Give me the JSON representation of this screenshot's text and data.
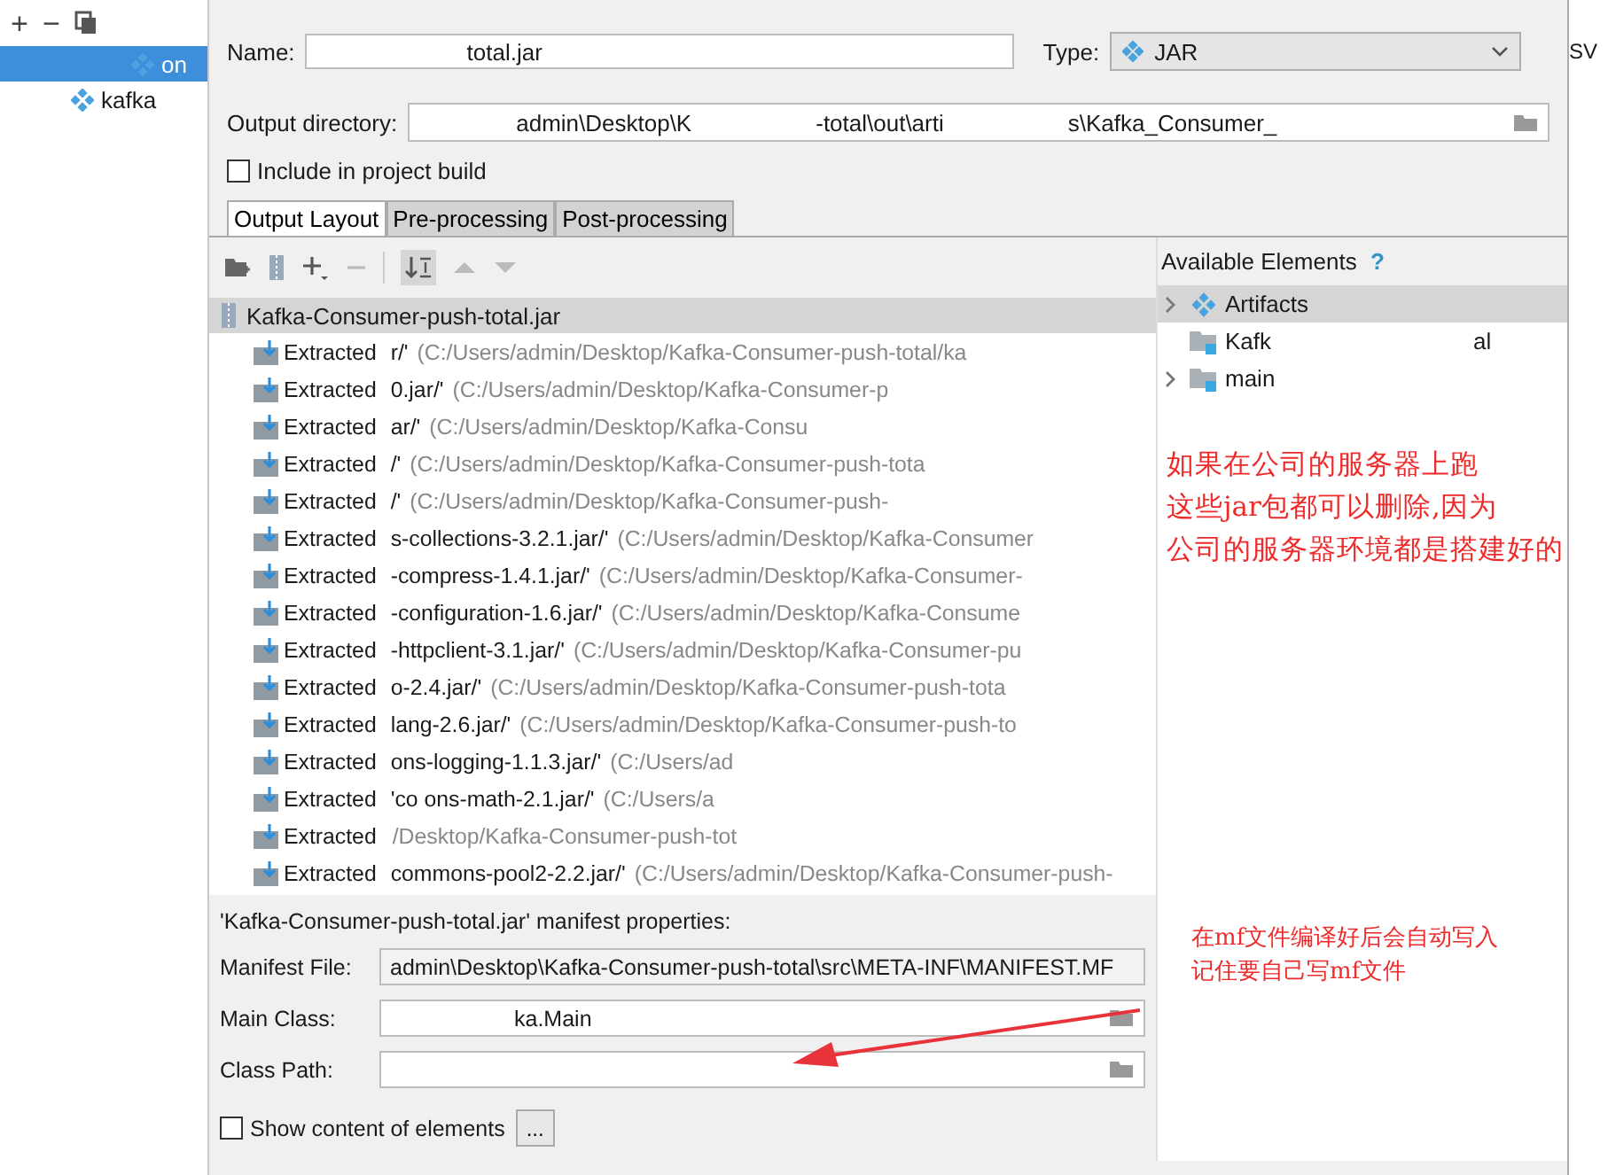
{
  "sidebar": {
    "toolbar": [
      "+",
      "−"
    ],
    "items": [
      {
        "label": "on",
        "selected": true
      },
      {
        "label": "kafka",
        "selected": false
      }
    ]
  },
  "form": {
    "name_label": "Name:",
    "name_value": "total.jar",
    "type_label": "Type:",
    "type_value": "JAR",
    "output_label": "Output directory:",
    "output_parts": [
      "admin\\Desktop\\K",
      "-total\\out\\arti",
      "s\\Kafka_Consumer_"
    ],
    "include_label": "Include in project build",
    "include_checked": false
  },
  "tabs": [
    {
      "label": "Output Layout",
      "selected": true
    },
    {
      "label": "Pre-processing",
      "selected": false
    },
    {
      "label": "Post-processing",
      "selected": false
    }
  ],
  "layout": {
    "root": "Kafka-Consumer-push-total.jar",
    "rows": [
      {
        "label": "Extracted",
        "file": "r/'",
        "path": "(C:/Users/admin/Desktop/Kafka-Consumer-push-total/ka"
      },
      {
        "label": "Extracted",
        "file": "0.jar/'",
        "path": "(C:/Users/admin/Desktop/Kafka-Consumer-p"
      },
      {
        "label": "Extracted",
        "file": "ar/'",
        "path": "(C:/Users/admin/Desktop/Kafka-Consu"
      },
      {
        "label": "Extracted",
        "file": "/'",
        "path": "(C:/Users/admin/Desktop/Kafka-Consumer-push-tota"
      },
      {
        "label": "Extracted",
        "file": "/'",
        "path": "(C:/Users/admin/Desktop/Kafka-Consumer-push-"
      },
      {
        "label": "Extracted",
        "file": "s-collections-3.2.1.jar/'",
        "path": "(C:/Users/admin/Desktop/Kafka-Consumer"
      },
      {
        "label": "Extracted",
        "file": "-compress-1.4.1.jar/'",
        "path": "(C:/Users/admin/Desktop/Kafka-Consumer-"
      },
      {
        "label": "Extracted",
        "file": "-configuration-1.6.jar/'",
        "path": "(C:/Users/admin/Desktop/Kafka-Consume"
      },
      {
        "label": "Extracted",
        "file": "-httpclient-3.1.jar/'",
        "path": "(C:/Users/admin/Desktop/Kafka-Consumer-pu"
      },
      {
        "label": "Extracted",
        "file": "o-2.4.jar/'",
        "path": "(C:/Users/admin/Desktop/Kafka-Consumer-push-tota"
      },
      {
        "label": "Extracted",
        "file": "lang-2.6.jar/'",
        "path": "(C:/Users/admin/Desktop/Kafka-Consumer-push-to"
      },
      {
        "label": "Extracted",
        "file": "ons-logging-1.1.3.jar/'",
        "path": "(C:/Users/ad"
      },
      {
        "label": "Extracted",
        "file": "'co   ons-math-2.1.jar/'",
        "path": "(C:/Users/a"
      },
      {
        "label": "Extracted",
        "file": "",
        "path": "/Desktop/Kafka-Consumer-push-tot"
      },
      {
        "label": "Extracted",
        "file": "commons-pool2-2.2.jar/'",
        "path": "(C:/Users/admin/Desktop/Kafka-Consumer-push-"
      }
    ]
  },
  "available": {
    "title": "Available Elements",
    "help": "?",
    "items": [
      {
        "label": "Artifacts",
        "kind": "artifact",
        "expandable": true,
        "selected": true
      },
      {
        "label": "Kafk",
        "suffix": "al",
        "kind": "folder",
        "expandable": false,
        "selected": false
      },
      {
        "label": "main",
        "kind": "folder",
        "expandable": true,
        "selected": false
      }
    ]
  },
  "manifest": {
    "title": "'Kafka-Consumer-push-total.jar' manifest properties:",
    "fields": [
      {
        "label": "Manifest File:",
        "value": "admin\\Desktop\\Kafka-Consumer-push-total\\src\\META-INF\\MANIFEST.MF",
        "browse": false
      },
      {
        "label": "Main Class:",
        "value": "ka.Main",
        "browse": true
      },
      {
        "label": "Class Path:",
        "browse": true
      }
    ],
    "show_content_label": "Show content of elements",
    "show_content_checked": false,
    "more": "..."
  },
  "annotations": [
    {
      "lines": [
        "如果在公司的服务器上跑",
        "这些jar包都可以删除,因为",
        "公司的服务器环境都是搭建好的"
      ]
    },
    {
      "lines": [
        "在mf文件编译好后会自动写入",
        "记住要自己写mf文件"
      ]
    }
  ],
  "right_strip": "SV"
}
